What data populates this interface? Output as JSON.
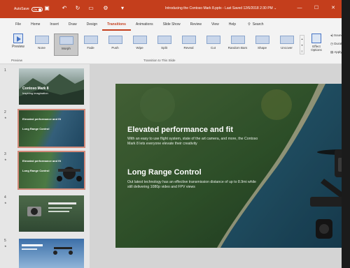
{
  "titlebar": {
    "autosave_label": "AutoSave",
    "autosave_state": "On",
    "doc_title": "Introducing the Contoso Mark 8.pptx",
    "saved_status": "Last Saved 12/6/2018 2:30 PM"
  },
  "tabs": [
    "File",
    "Home",
    "Insert",
    "Draw",
    "Design",
    "Transitions",
    "Animations",
    "Slide Show",
    "Review",
    "View",
    "Help"
  ],
  "active_tab": "Transitions",
  "search_label": "Search",
  "ribbon": {
    "preview_label": "Preview",
    "preview_group": "Preview",
    "transitions": [
      "None",
      "Morph",
      "Fade",
      "Push",
      "Wipe",
      "Split",
      "Reveal",
      "Cut",
      "Random Bars",
      "Shape",
      "Uncover"
    ],
    "selected_transition": "Morph",
    "transition_group": "Transition to This Slide",
    "effect_options_line1": "Effect",
    "effect_options_line2": "Options",
    "timing": [
      "Sound",
      "Duration",
      "Apply To"
    ]
  },
  "thumbnails": [
    {
      "num": "1",
      "title": "Contoso Mark 8",
      "subtitle": "Inspiring imagination"
    },
    {
      "num": "2",
      "title": "Elevated performance and fit",
      "subtitle": "Long Range Control"
    },
    {
      "num": "3",
      "title": "Elevated performance and fit",
      "subtitle": "Long Range Control"
    },
    {
      "num": "4",
      "title": "",
      "subtitle": ""
    },
    {
      "num": "5",
      "title": "",
      "subtitle": ""
    }
  ],
  "slide": {
    "heading1": "Elevated performance and fit",
    "body1": "With an easy to use flight system, state of the art camera, and more, the Contoso Mark 8 lets everyone elevate their creativity",
    "heading2": "Long Range Control",
    "body2": "Out latest technology has an effective transmission distance of up to 8.9mi while still delivering 1080p video and FPV views"
  }
}
